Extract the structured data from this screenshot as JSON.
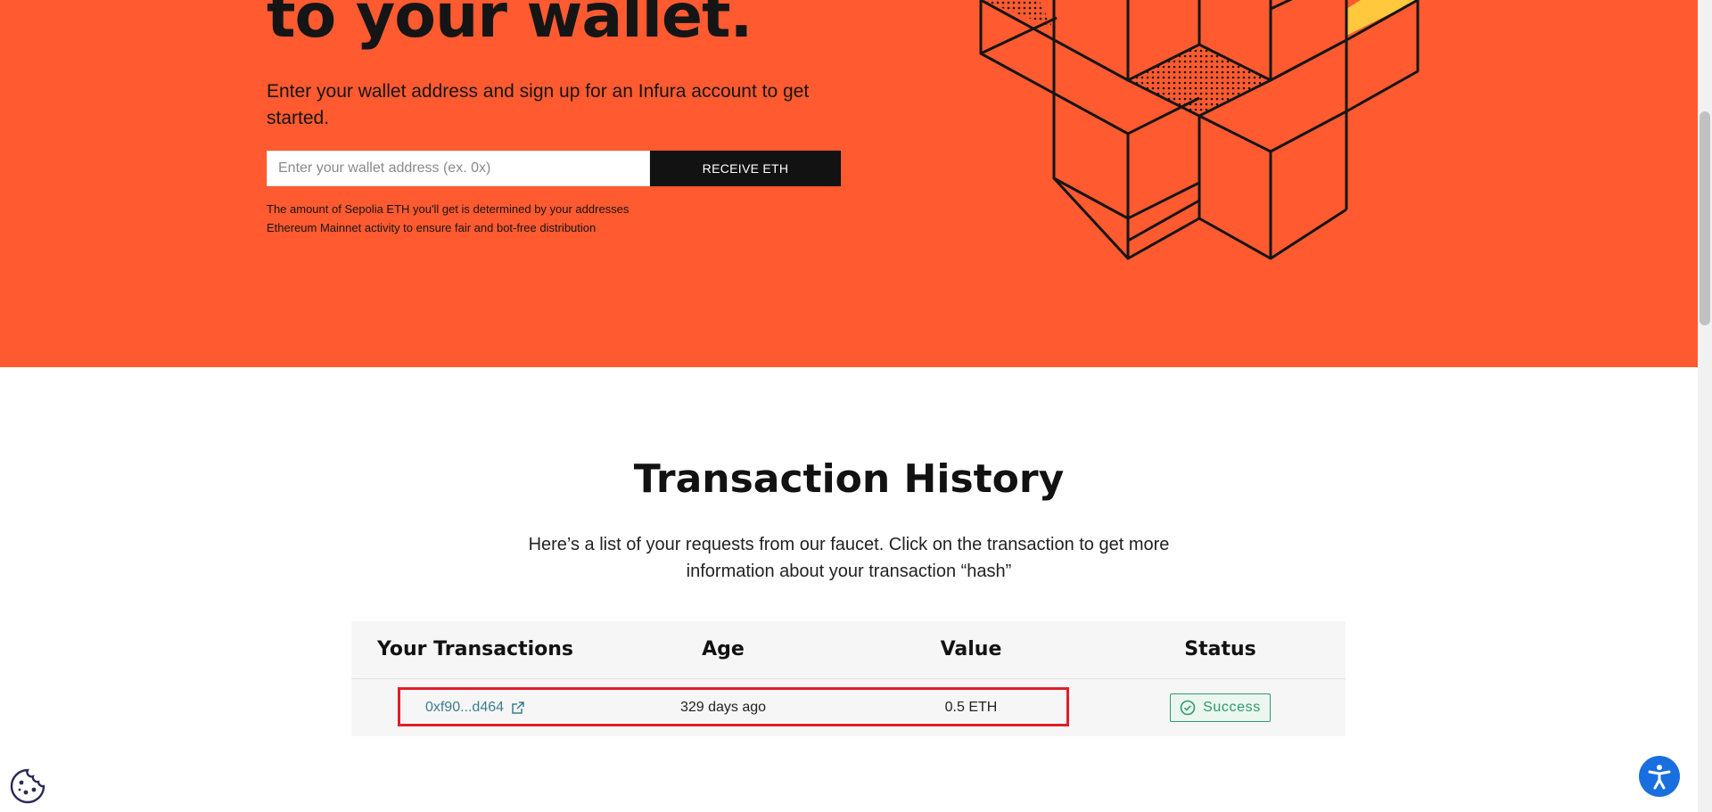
{
  "hero": {
    "title": "to your wallet.",
    "description": "Enter your wallet address and sign up for an Infura account to get started.",
    "wallet_input": {
      "placeholder": "Enter your wallet address (ex. 0x)",
      "value": ""
    },
    "receive_button": "RECEIVE ETH",
    "note": "The amount of Sepolia ETH you'll get is determined by your addresses Ethereum Mainnet activity to ensure fair and bot-free distribution",
    "colors": {
      "background": "#ff5a30",
      "button": "#121212",
      "accent_yellow": "#ffc83d"
    }
  },
  "history": {
    "title": "Transaction History",
    "description": "Here’s a list of your requests from our faucet. Click on the transaction to get more information about your transaction “hash”",
    "columns": [
      "Your Transactions",
      "Age",
      "Value",
      "Status"
    ],
    "rows": [
      {
        "tx": "0xf90...d464",
        "age": "329 days ago",
        "value": "0.5 ETH",
        "status": "Success"
      }
    ]
  },
  "icons": {
    "external_link": "external-link-icon",
    "status": "check-circle-icon",
    "cookie": "cookie-icon",
    "accessibility": "accessibility-icon"
  },
  "colors": {
    "link": "#3b7c8f",
    "success": "#2e9a6a",
    "highlight": "#e01e2a",
    "accessibility": "#1a6fe0"
  }
}
